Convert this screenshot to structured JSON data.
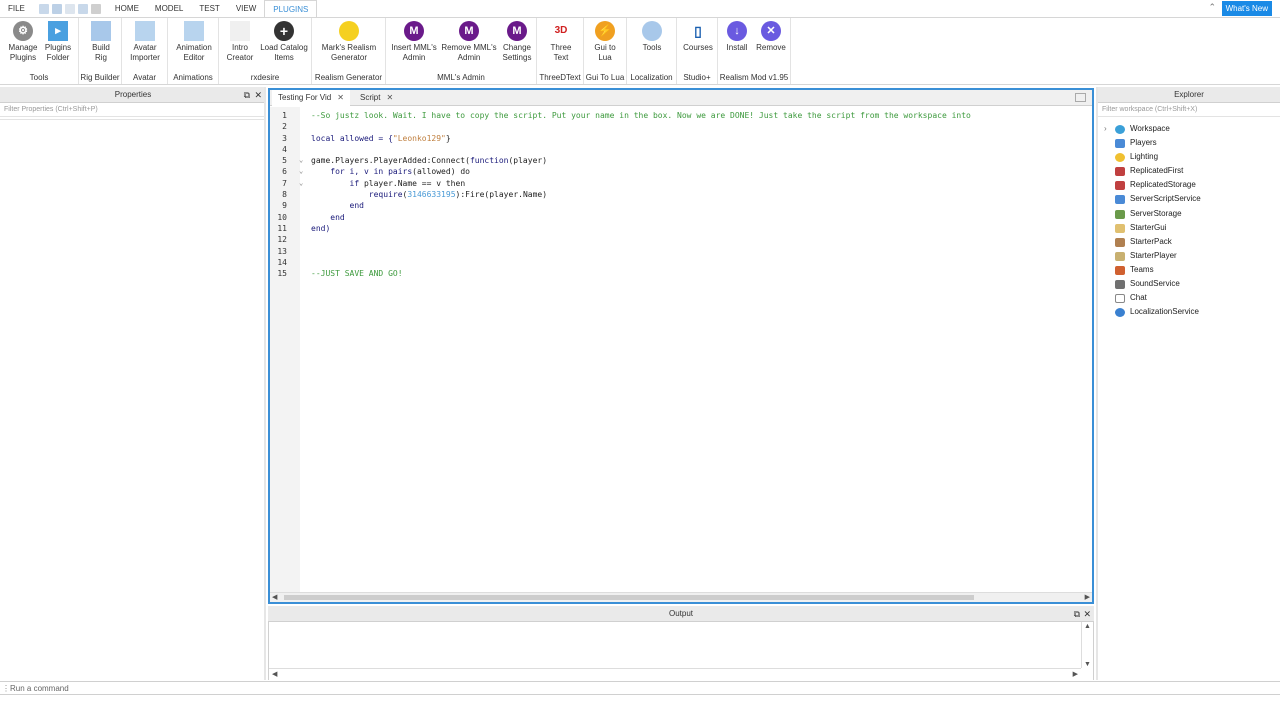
{
  "menubar": {
    "file": "FILE",
    "tabs": [
      "HOME",
      "MODEL",
      "TEST",
      "VIEW",
      "PLUGINS"
    ],
    "whats_new": "What's New"
  },
  "ribbon": {
    "groups": [
      {
        "label": "Tools",
        "buttons": [
          "Manage\nPlugins",
          "Plugins\nFolder"
        ]
      },
      {
        "label": "Rig Builder",
        "buttons": [
          "Build\nRig"
        ]
      },
      {
        "label": "Avatar",
        "buttons": [
          "Avatar\nImporter"
        ]
      },
      {
        "label": "Animations",
        "buttons": [
          "Animation\nEditor"
        ]
      },
      {
        "label": "rxdesire",
        "buttons": [
          "Intro\nCreator",
          "Load Catalog\nItems"
        ]
      },
      {
        "label": "Realism Generator",
        "buttons": [
          "Mark's Realism\nGenerator"
        ]
      },
      {
        "label": "MML's Admin",
        "buttons": [
          "Insert MML's\nAdmin",
          "Remove MML's\nAdmin",
          "Change\nSettings"
        ]
      },
      {
        "label": "ThreeDText",
        "buttons": [
          "Three\nText"
        ]
      },
      {
        "label": "Gui To Lua",
        "buttons": [
          "Gui to\nLua"
        ]
      },
      {
        "label": "Localization",
        "buttons": [
          "Tools"
        ]
      },
      {
        "label": "Studio+",
        "buttons": [
          "Courses"
        ]
      },
      {
        "label": "Realism Mod v1.95",
        "buttons": [
          "Install",
          "Remove"
        ]
      }
    ]
  },
  "properties": {
    "title": "Properties",
    "filter_placeholder": "Filter Properties (Ctrl+Shift+P)"
  },
  "editor": {
    "tabs": [
      "Testing For Vid",
      "Script"
    ],
    "line_numbers": [
      "1",
      "2",
      "3",
      "4",
      "5",
      "6",
      "7",
      "8",
      "9",
      "10",
      "11",
      "12",
      "13",
      "14",
      "15"
    ],
    "lines": {
      "l1": "--So justz look. Wait. I have to copy the script. Put your name in the box. Now we are DONE! Just take the script from the workspace into",
      "l3a": "local allowed = {",
      "l3b": "\"Leonko129\"",
      "l3c": "}",
      "l5a": "game.Players.PlayerAdded:Connect(",
      "l5b": "function",
      "l5c": "(player)",
      "l6a": "    for i, v in pairs",
      "l6b": "(allowed) do",
      "l7a": "        if ",
      "l7b": "player.Name == v then",
      "l8a": "            require",
      "l8b": "(",
      "l8c": "3146633195",
      "l8d": "):Fire(player.Name)",
      "l9": "        end",
      "l10": "    end",
      "l11": "end)",
      "l15": "--JUST SAVE AND GO!"
    }
  },
  "output": {
    "title": "Output"
  },
  "explorer": {
    "title": "Explorer",
    "filter_placeholder": "Filter workspace (Ctrl+Shift+X)",
    "items": [
      "Workspace",
      "Players",
      "Lighting",
      "ReplicatedFirst",
      "ReplicatedStorage",
      "ServerScriptService",
      "ServerStorage",
      "StarterGui",
      "StarterPack",
      "StarterPlayer",
      "Teams",
      "SoundService",
      "Chat",
      "LocalizationService"
    ]
  },
  "command_bar": {
    "placeholder": "Run a command"
  }
}
